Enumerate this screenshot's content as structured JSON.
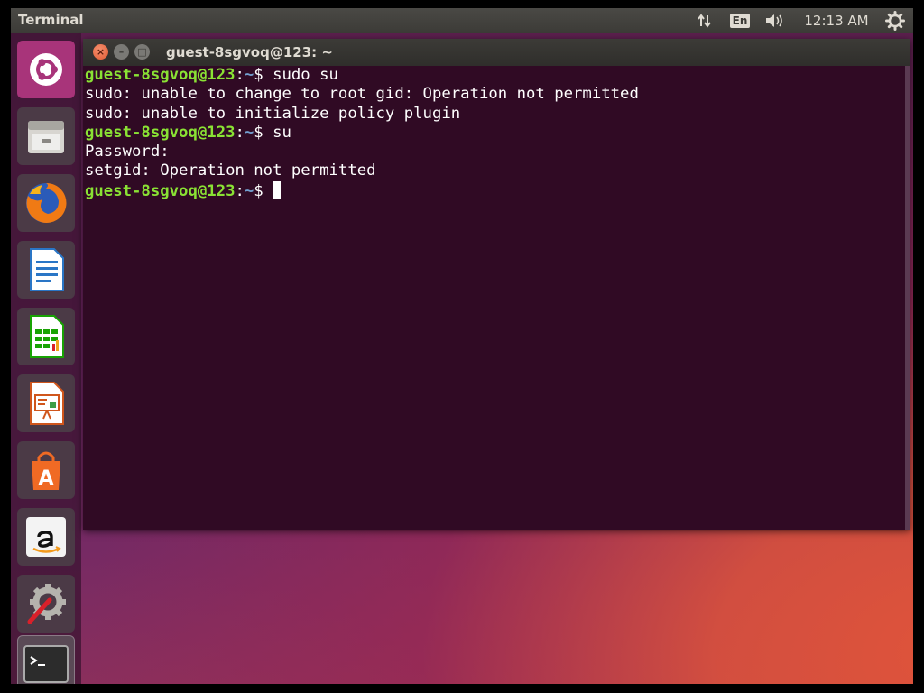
{
  "panel": {
    "app_title": "Terminal",
    "lang": "En",
    "clock": "12:13 AM"
  },
  "window": {
    "title": "guest-8sgvoq@123: ~",
    "close": "×",
    "minimize": "–",
    "maximize": "□"
  },
  "terminal": {
    "prompt_user": "guest-8sgvoq@123",
    "prompt_colon": ":",
    "prompt_path": "~",
    "prompt_dollar": "$ ",
    "lines": [
      {
        "type": "prompt",
        "cmd": "sudo su"
      },
      {
        "type": "output",
        "text": "sudo: unable to change to root gid: Operation not permitted"
      },
      {
        "type": "output",
        "text": "sudo: unable to initialize policy plugin"
      },
      {
        "type": "prompt",
        "cmd": "su"
      },
      {
        "type": "output",
        "text": "Password:"
      },
      {
        "type": "output",
        "text": "setgid: Operation not permitted"
      },
      {
        "type": "prompt",
        "cmd": ""
      }
    ]
  },
  "launcher": {
    "items": [
      {
        "icon": "ubuntu-dash-icon"
      },
      {
        "icon": "files-icon"
      },
      {
        "icon": "firefox-icon"
      },
      {
        "icon": "libreoffice-writer-icon"
      },
      {
        "icon": "libreoffice-calc-icon"
      },
      {
        "icon": "libreoffice-impress-icon"
      },
      {
        "icon": "software-center-icon"
      },
      {
        "icon": "amazon-icon"
      },
      {
        "icon": "system-settings-icon"
      },
      {
        "icon": "terminal-icon"
      }
    ]
  },
  "icons": {
    "network": "network-updown-icon",
    "sound": "sound-icon",
    "gear": "gear-icon"
  },
  "colors": {
    "terminal_bg": "#300a24",
    "prompt_user": "#8ae234",
    "prompt_path": "#729fcf",
    "close_button": "#e05a32"
  }
}
